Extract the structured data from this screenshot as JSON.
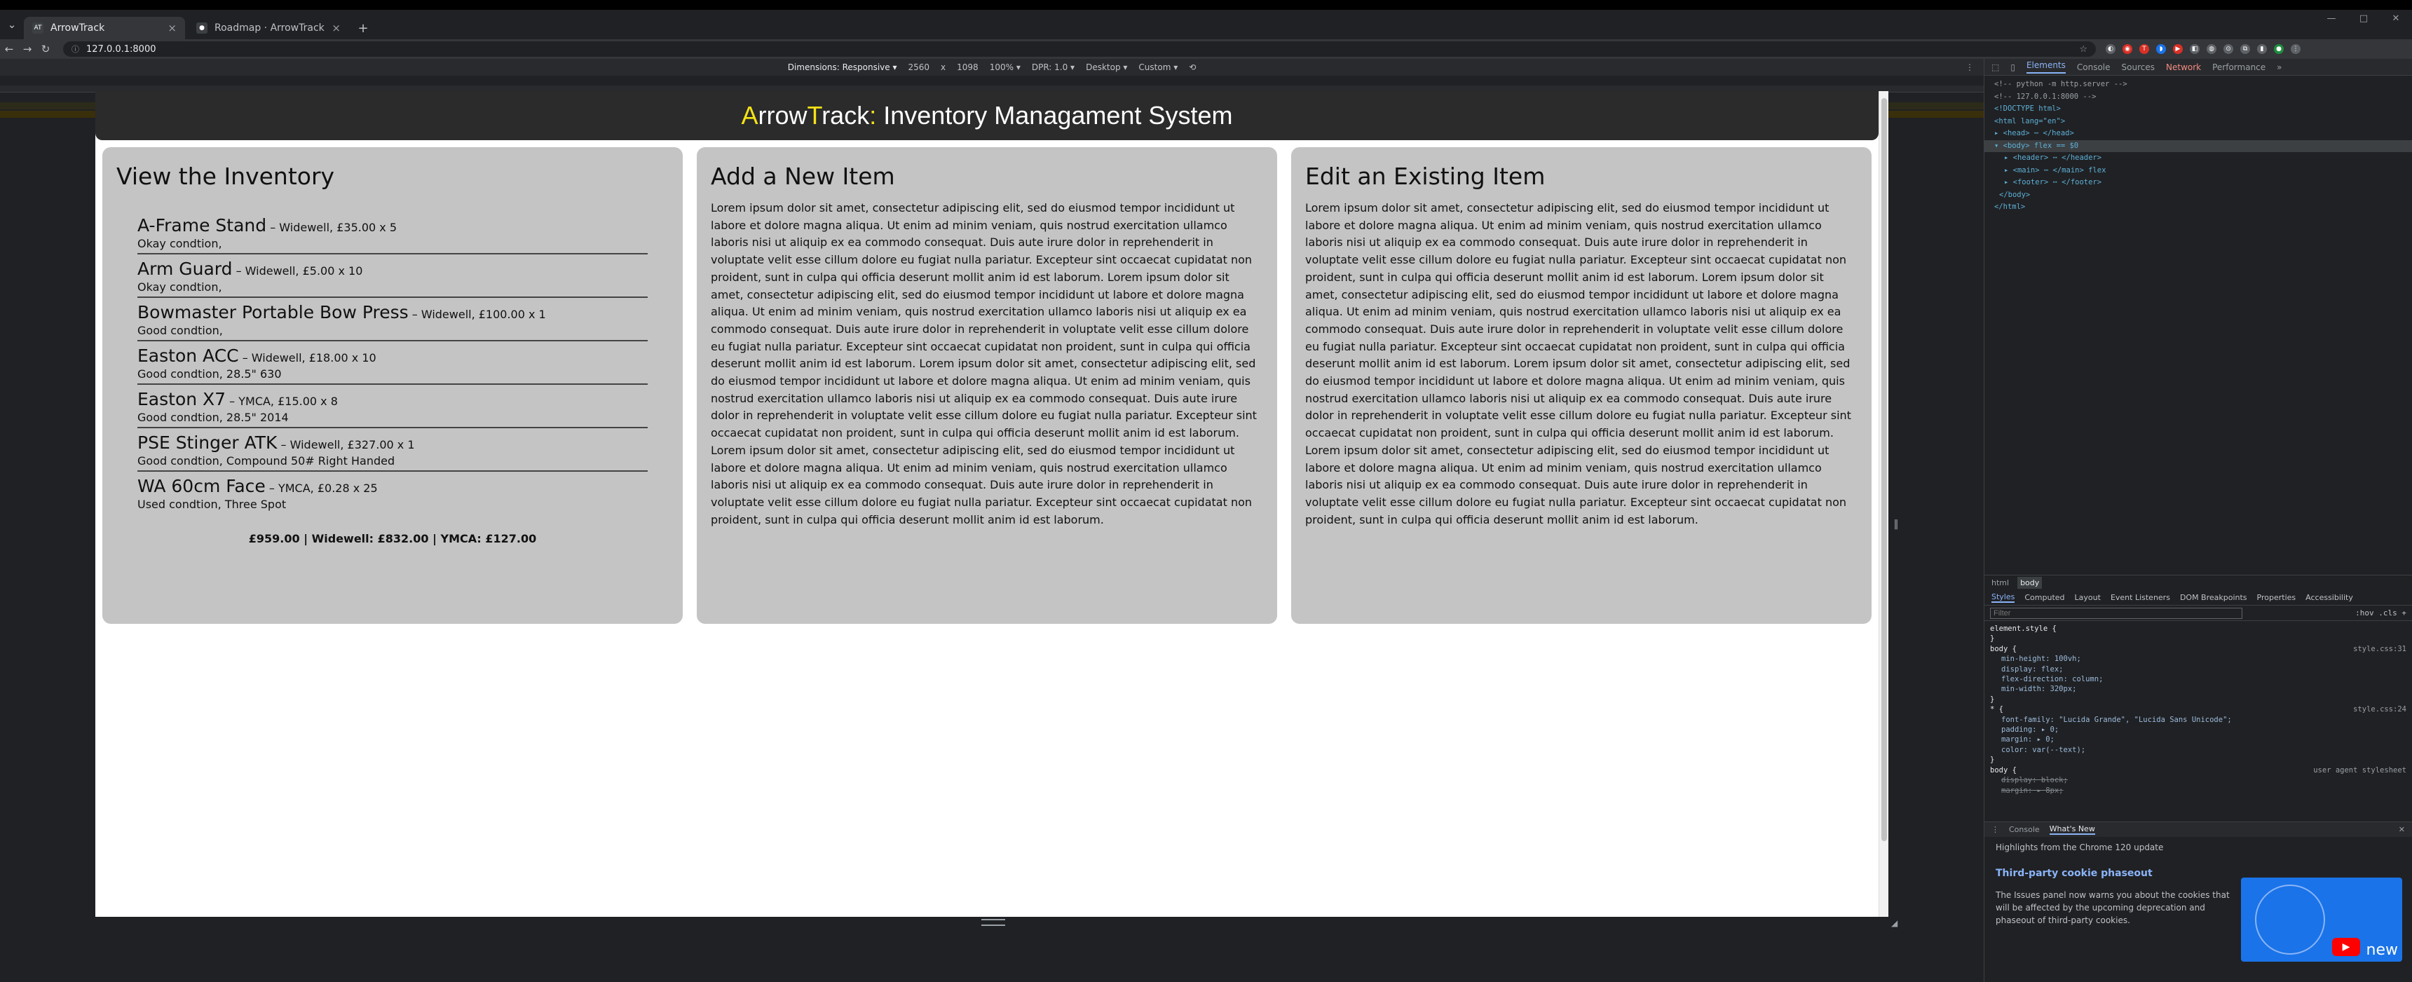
{
  "browser": {
    "tabs": [
      {
        "favicon": "AT",
        "title": "ArrowTrack"
      },
      {
        "favicon": "github-icon",
        "title": "Roadmap · ArrowTrack"
      }
    ],
    "url": "127.0.0.1:8000"
  },
  "device_toolbar": {
    "dimensions_label": "Dimensions: Responsive ▾",
    "width": "2560",
    "x": "x",
    "height": "1098",
    "zoom": "100% ▾",
    "dpr": "DPR: 1.0 ▾",
    "device": "Desktop ▾",
    "throttle": "Custom ▾"
  },
  "site": {
    "title_a": "A",
    "title_rrow": "rrow",
    "title_t": "T",
    "title_rack": "rack",
    "title_colon": ":",
    "title_rest": " Inventory Managament System"
  },
  "inventory": {
    "heading": "View the Inventory",
    "items": [
      {
        "name": "A-Frame Stand",
        "meta": " – Widewell, £35.00 x 5",
        "cond": "Okay condtion,"
      },
      {
        "name": "Arm Guard",
        "meta": " – Widewell, £5.00 x 10",
        "cond": "Okay condtion,"
      },
      {
        "name": "Bowmaster Portable Bow Press",
        "meta": " – Widewell, £100.00 x 1",
        "cond": "Good condtion,"
      },
      {
        "name": "Easton ACC",
        "meta": " – Widewell, £18.00 x 10",
        "cond": "Good condtion, 28.5\" 630"
      },
      {
        "name": "Easton X7",
        "meta": " – YMCA, £15.00 x 8",
        "cond": "Good condtion, 28.5\" 2014"
      },
      {
        "name": "PSE Stinger ATK",
        "meta": " – Widewell, £327.00 x 1",
        "cond": "Good condtion, Compound 50# Right Handed"
      },
      {
        "name": "WA 60cm Face",
        "meta": " – YMCA, £0.28 x 25",
        "cond": "Used condtion, Three Spot"
      }
    ],
    "totals": "£959.00 | Widewell: £832.00 | YMCA: £127.00"
  },
  "add_item": {
    "heading": "Add a New Item",
    "body": "Lorem ipsum dolor sit amet, consectetur adipiscing elit, sed do eiusmod tempor incididunt ut labore et dolore magna aliqua. Ut enim ad minim veniam, quis nostrud exercitation ullamco laboris nisi ut aliquip ex ea commodo consequat. Duis aute irure dolor in reprehenderit in voluptate velit esse cillum dolore eu fugiat nulla pariatur. Excepteur sint occaecat cupidatat non proident, sunt in culpa qui officia deserunt mollit anim id est laborum. Lorem ipsum dolor sit amet, consectetur adipiscing elit, sed do eiusmod tempor incididunt ut labore et dolore magna aliqua. Ut enim ad minim veniam, quis nostrud exercitation ullamco laboris nisi ut aliquip ex ea commodo consequat. Duis aute irure dolor in reprehenderit in voluptate velit esse cillum dolore eu fugiat nulla pariatur. Excepteur sint occaecat cupidatat non proident, sunt in culpa qui officia deserunt mollit anim id est laborum. Lorem ipsum dolor sit amet, consectetur adipiscing elit, sed do eiusmod tempor incididunt ut labore et dolore magna aliqua. Ut enim ad minim veniam, quis nostrud exercitation ullamco laboris nisi ut aliquip ex ea commodo consequat. Duis aute irure dolor in reprehenderit in voluptate velit esse cillum dolore eu fugiat nulla pariatur. Excepteur sint occaecat cupidatat non proident, sunt in culpa qui officia deserunt mollit anim id est laborum. Lorem ipsum dolor sit amet, consectetur adipiscing elit, sed do eiusmod tempor incididunt ut labore et dolore magna aliqua. Ut enim ad minim veniam, quis nostrud exercitation ullamco laboris nisi ut aliquip ex ea commodo consequat. Duis aute irure dolor in reprehenderit in voluptate velit esse cillum dolore eu fugiat nulla pariatur. Excepteur sint occaecat cupidatat non proident, sunt in culpa qui officia deserunt mollit anim id est laborum."
  },
  "edit_item": {
    "heading": "Edit an Existing Item",
    "body": "Lorem ipsum dolor sit amet, consectetur adipiscing elit, sed do eiusmod tempor incididunt ut labore et dolore magna aliqua. Ut enim ad minim veniam, quis nostrud exercitation ullamco laboris nisi ut aliquip ex ea commodo consequat. Duis aute irure dolor in reprehenderit in voluptate velit esse cillum dolore eu fugiat nulla pariatur. Excepteur sint occaecat cupidatat non proident, sunt in culpa qui officia deserunt mollit anim id est laborum. Lorem ipsum dolor sit amet, consectetur adipiscing elit, sed do eiusmod tempor incididunt ut labore et dolore magna aliqua. Ut enim ad minim veniam, quis nostrud exercitation ullamco laboris nisi ut aliquip ex ea commodo consequat. Duis aute irure dolor in reprehenderit in voluptate velit esse cillum dolore eu fugiat nulla pariatur. Excepteur sint occaecat cupidatat non proident, sunt in culpa qui officia deserunt mollit anim id est laborum. Lorem ipsum dolor sit amet, consectetur adipiscing elit, sed do eiusmod tempor incididunt ut labore et dolore magna aliqua. Ut enim ad minim veniam, quis nostrud exercitation ullamco laboris nisi ut aliquip ex ea commodo consequat. Duis aute irure dolor in reprehenderit in voluptate velit esse cillum dolore eu fugiat nulla pariatur. Excepteur sint occaecat cupidatat non proident, sunt in culpa qui officia deserunt mollit anim id est laborum. Lorem ipsum dolor sit amet, consectetur adipiscing elit, sed do eiusmod tempor incididunt ut labore et dolore magna aliqua. Ut enim ad minim veniam, quis nostrud exercitation ullamco laboris nisi ut aliquip ex ea commodo consequat. Duis aute irure dolor in reprehenderit in voluptate velit esse cillum dolore eu fugiat nulla pariatur. Excepteur sint occaecat cupidatat non proident, sunt in culpa qui officia deserunt mollit anim id est laborum."
  },
  "devtools": {
    "tabs": [
      "Elements",
      "Console",
      "Sources",
      "Network",
      "Performance",
      "»"
    ],
    "dom": [
      "<!-- python -m http.server -->",
      "<!-- 127.0.0.1:8000 -->",
      "<!DOCTYPE html>",
      "<html lang=\"en\">",
      "▸ <head> ⋯ </head>",
      "▾ <body> flex == $0",
      "▸ <header> ⋯ </header>",
      "▸ <main> ⋯ </main> flex",
      "▸ <footer> ⋯ </footer>",
      "</body>",
      "</html>"
    ],
    "crumbs": [
      "html",
      "body"
    ],
    "subtabs": [
      "Styles",
      "Computed",
      "Layout",
      "Event Listeners",
      "DOM Breakpoints",
      "Properties",
      "Accessibility"
    ],
    "filter_placeholder": "Filter",
    "filter_opts": ":hov  .cls  +",
    "styles": {
      "el_style": "element.style {",
      "close": "}",
      "rule1_sel": "body {",
      "rule1_src": "style.css:31",
      "rule1_props": [
        "min-height: 100vh;",
        "display: flex;",
        "flex-direction: column;",
        "min-width: 320px;"
      ],
      "rule2_sel": "* {",
      "rule2_src": "style.css:24",
      "rule2_props": [
        "font-family: \"Lucida Grande\", \"Lucida Sans Unicode\";",
        "padding: ▸ 0;",
        "margin: ▸ 0;",
        "color: var(--text);"
      ],
      "rule3_sel": "body {",
      "rule3_src": "user agent stylesheet",
      "rule3_props": [
        "display: block;",
        "margin: ▸ 8px;"
      ]
    },
    "drawer": {
      "tabs": [
        "Console",
        "What's New"
      ],
      "highlights": "Highlights from the Chrome 120 update",
      "feature_title": "Third-party cookie phaseout",
      "feature_desc": "The Issues panel now warns you about the cookies that will be affected by the upcoming deprecation and phaseout of third-party cookies.",
      "promo_text": "new"
    }
  }
}
